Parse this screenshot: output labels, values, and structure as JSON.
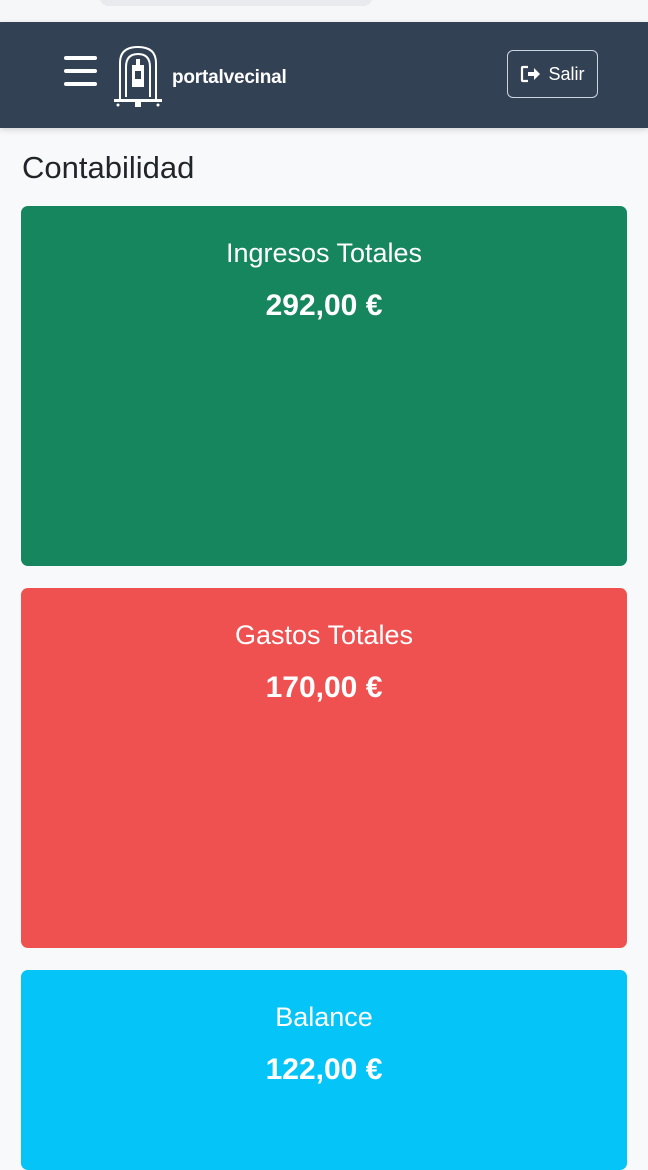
{
  "header": {
    "brand_name": "portalvecinal",
    "logout_label": "Salir",
    "colors": {
      "navbar": "#334155"
    }
  },
  "page": {
    "title": "Contabilidad"
  },
  "cards": {
    "income": {
      "label": "Ingresos Totales",
      "amount": "292,00 €",
      "color": "#16865e"
    },
    "expenses": {
      "label": "Gastos Totales",
      "amount": "170,00 €",
      "color": "#ef5050"
    },
    "balance": {
      "label": "Balance",
      "amount": "122,00 €",
      "color": "#04c4f8"
    }
  },
  "icons": {
    "menu": "hamburger-menu-icon",
    "logo": "town-hall-logo-icon",
    "logout": "sign-out-icon"
  }
}
